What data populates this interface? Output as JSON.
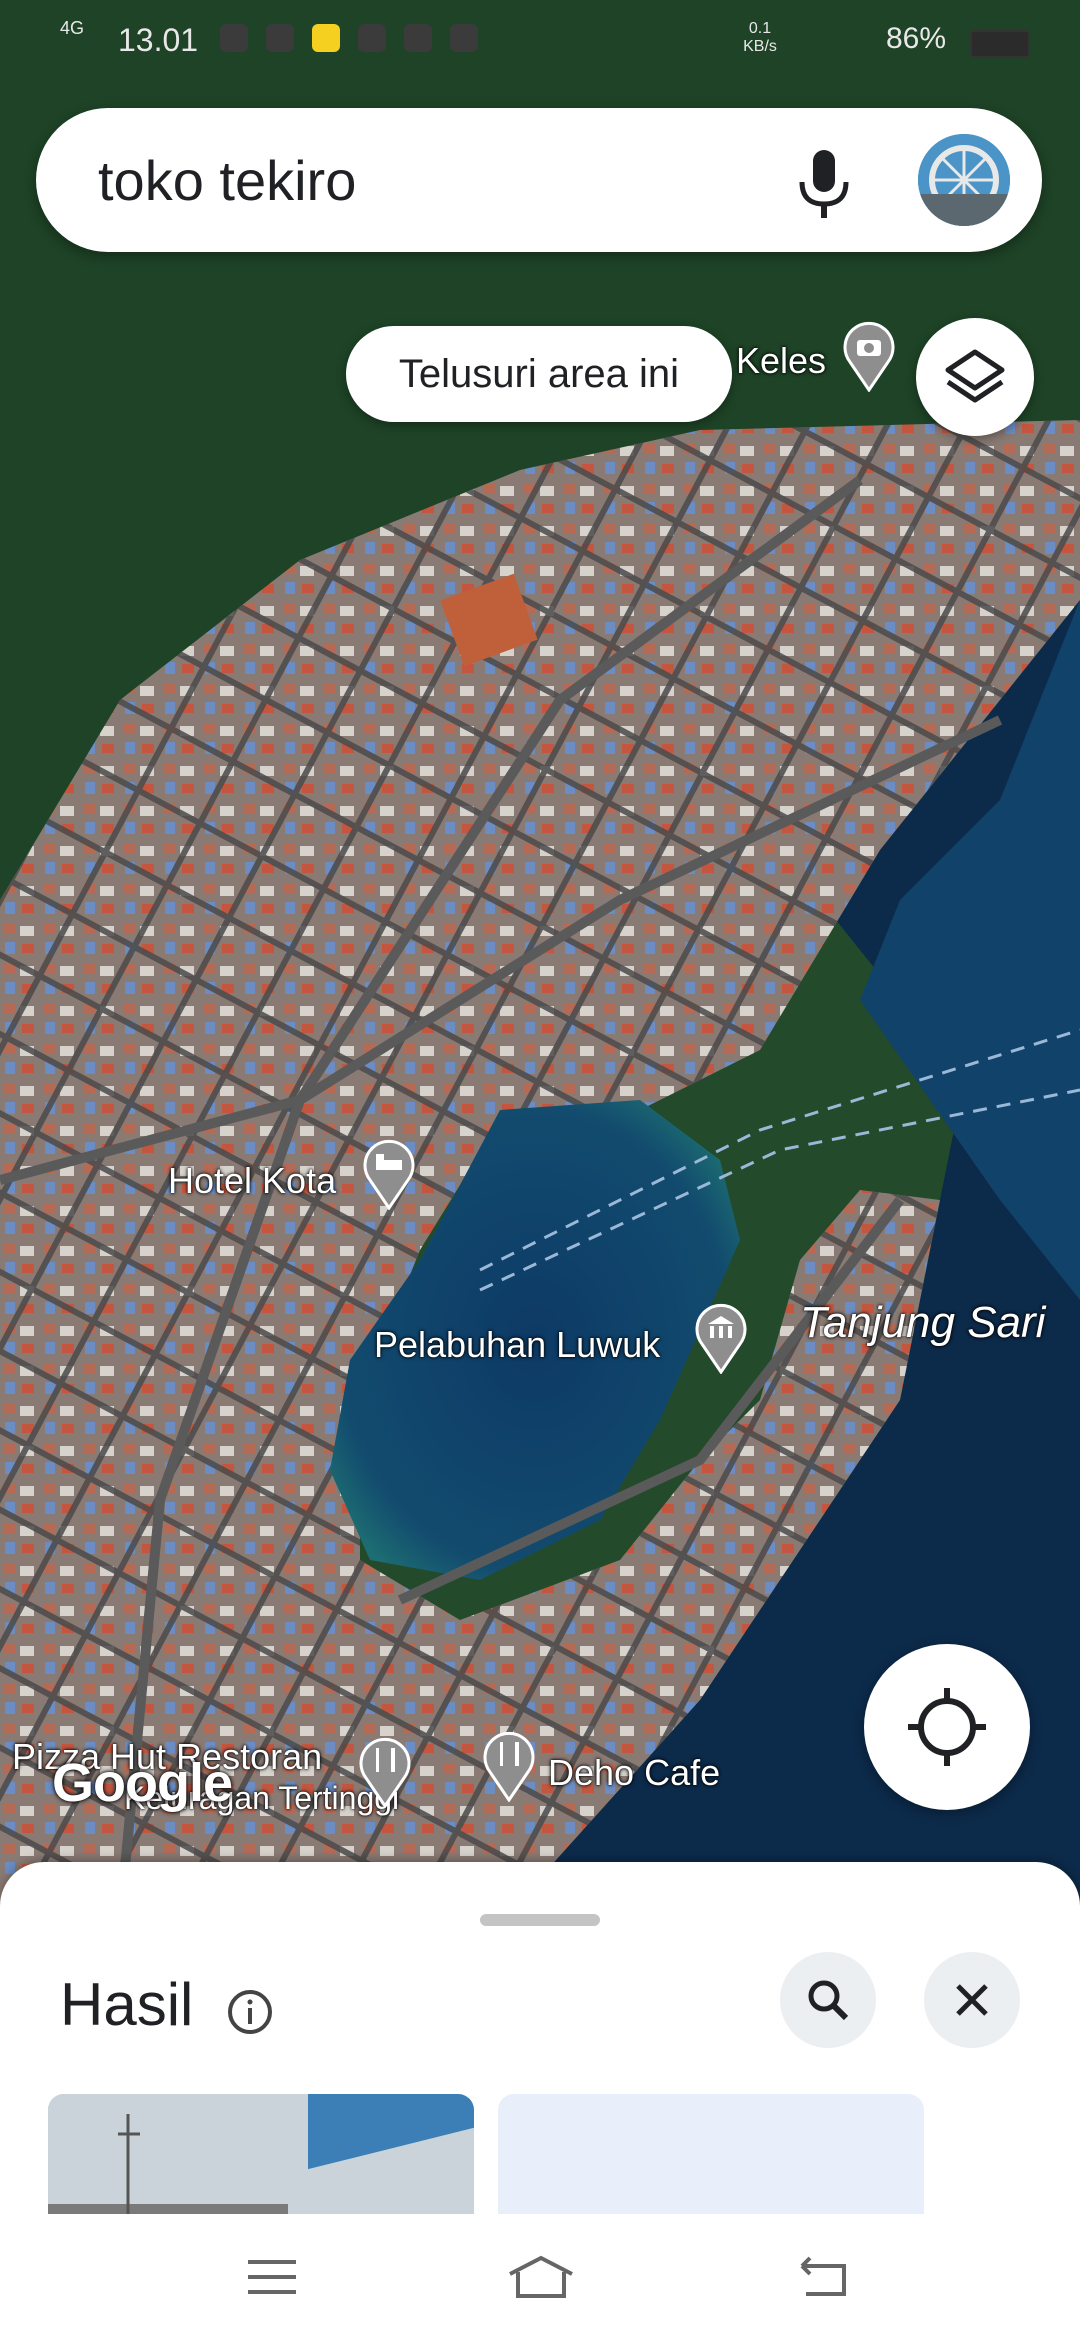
{
  "status_bar": {
    "network": "4G",
    "time": "13.01",
    "speed": "0.1 KB/s",
    "battery_pct": "86%"
  },
  "search": {
    "query": "toko tekiro",
    "mic_icon": "mic-icon",
    "avatar_icon": "account-avatar"
  },
  "map": {
    "search_area_chip": "Telusuri area ini",
    "labels": {
      "keles": "Keles",
      "hotel_kota": "Hotel Kota",
      "pelabuhan_luwuk": "Pelabuhan Luwuk",
      "tanjung_sari": "Tanjung Sari",
      "pizza_hut": "Pizza Hut Restoran",
      "keluragan": "Keluragan Tertinggi",
      "deho_cafe": "Deho Cafe"
    },
    "watermark": "Google",
    "icons": [
      "layers-icon",
      "my-location-icon",
      "camera-pin-icon",
      "hotel-pin-icon",
      "museum-pin-icon",
      "restaurant-pin-icon"
    ]
  },
  "sheet": {
    "title": "Hasil",
    "info_icon": "info-icon",
    "search_icon": "search-icon",
    "close_icon": "close-icon"
  },
  "nav_bar": {
    "icons": [
      "menu-icon",
      "home-icon",
      "back-icon"
    ]
  }
}
